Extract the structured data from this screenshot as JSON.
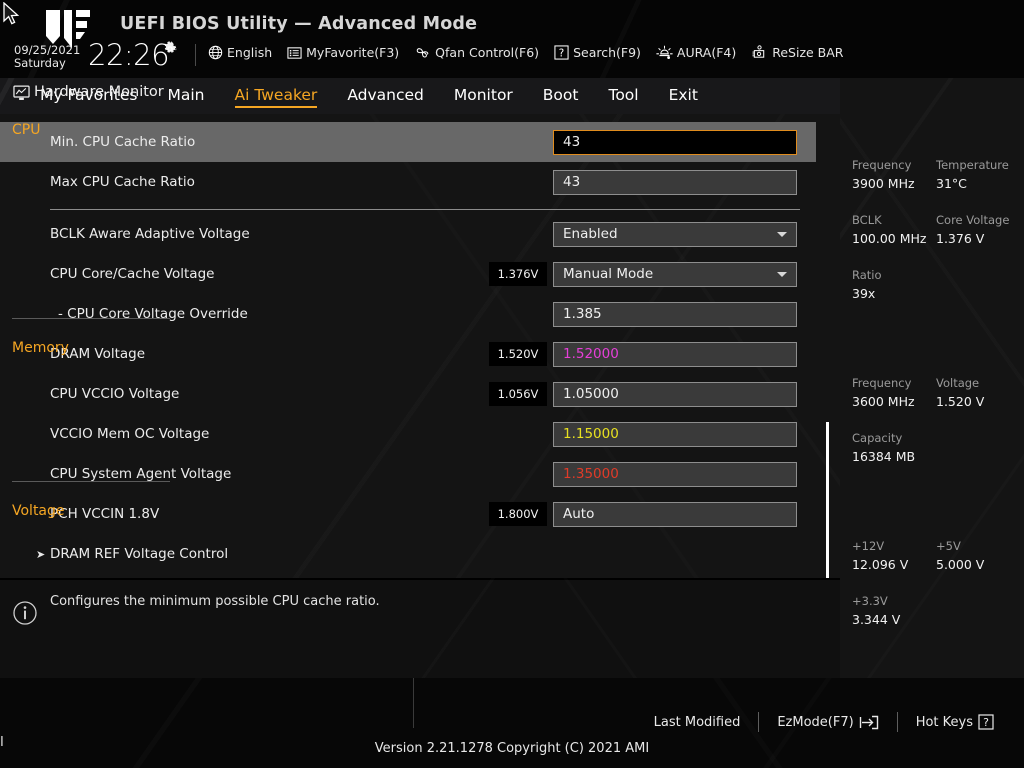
{
  "header": {
    "title": "UEFI BIOS Utility — Advanced Mode",
    "date": "09/25/2021",
    "weekday": "Saturday",
    "time": "22:26",
    "gear_icon": "gear-icon",
    "items": [
      {
        "icon": "globe-icon",
        "label": "English"
      },
      {
        "icon": "list-icon",
        "label": "MyFavorite(F3)"
      },
      {
        "icon": "fan-icon",
        "label": "Qfan Control(F6)"
      },
      {
        "icon": "question-box-icon",
        "label": "Search(F9)"
      },
      {
        "icon": "aura-icon",
        "label": "AURA(F4)"
      },
      {
        "icon": "gpu-icon",
        "label": "ReSize BAR"
      }
    ]
  },
  "nav": {
    "tabs": [
      {
        "label": "My Favorites",
        "active": false
      },
      {
        "label": "Main",
        "active": false
      },
      {
        "label": "Ai Tweaker",
        "active": true
      },
      {
        "label": "Advanced",
        "active": false
      },
      {
        "label": "Monitor",
        "active": false
      },
      {
        "label": "Boot",
        "active": false
      },
      {
        "label": "Tool",
        "active": false
      },
      {
        "label": "Exit",
        "active": false
      }
    ],
    "accent_color": "#f5a623"
  },
  "settings": {
    "rows": [
      {
        "label": "Min. CPU Cache Ratio",
        "value": "43",
        "badge": "",
        "type": "text",
        "selected": true,
        "focused": true,
        "value_color": "#eeeeee",
        "indent": false,
        "submenu": false
      },
      {
        "label": "Max CPU Cache Ratio",
        "value": "43",
        "badge": "",
        "type": "text",
        "selected": false,
        "focused": false,
        "value_color": "#eeeeee",
        "indent": false,
        "submenu": false
      },
      {
        "label": "BCLK Aware Adaptive Voltage",
        "value": "Enabled",
        "badge": "",
        "type": "combo",
        "selected": false,
        "focused": false,
        "value_color": "#eeeeee",
        "indent": false,
        "submenu": false
      },
      {
        "label": "CPU Core/Cache Voltage",
        "value": "Manual Mode",
        "badge": "1.376V",
        "type": "combo",
        "selected": false,
        "focused": false,
        "value_color": "#eeeeee",
        "indent": false,
        "submenu": false
      },
      {
        "label": "- CPU Core Voltage Override",
        "value": "1.385",
        "badge": "",
        "type": "text",
        "selected": false,
        "focused": false,
        "value_color": "#eeeeee",
        "indent": true,
        "submenu": false
      },
      {
        "label": "DRAM Voltage",
        "value": "1.52000",
        "badge": "1.520V",
        "type": "text",
        "selected": false,
        "focused": false,
        "value_color": "#e63fd8",
        "indent": false,
        "submenu": false
      },
      {
        "label": "CPU VCCIO Voltage",
        "value": "1.05000",
        "badge": "1.056V",
        "type": "text",
        "selected": false,
        "focused": false,
        "value_color": "#eeeeee",
        "indent": false,
        "submenu": false
      },
      {
        "label": "VCCIO Mem OC Voltage",
        "value": "1.15000",
        "badge": "",
        "type": "text",
        "selected": false,
        "focused": false,
        "value_color": "#e8e020",
        "indent": false,
        "submenu": false
      },
      {
        "label": "CPU System Agent Voltage",
        "value": "1.35000",
        "badge": "",
        "type": "text",
        "selected": false,
        "focused": false,
        "value_color": "#e03b28",
        "indent": false,
        "submenu": false
      },
      {
        "label": "PCH VCCIN 1.8V",
        "value": "Auto",
        "badge": "1.800V",
        "type": "text",
        "selected": false,
        "focused": false,
        "value_color": "#eeeeee",
        "indent": false,
        "submenu": false
      },
      {
        "label": "DRAM REF Voltage Control",
        "value": "",
        "badge": "",
        "type": "none",
        "selected": false,
        "focused": false,
        "value_color": "#eeeeee",
        "indent": false,
        "submenu": true
      }
    ]
  },
  "help": {
    "icon": "info-icon",
    "text": "Configures the minimum possible CPU cache ratio."
  },
  "hardware_monitor": {
    "title": "Hardware Monitor",
    "icon": "monitor-icon",
    "sections": [
      {
        "name": "CPU",
        "entries": [
          {
            "key": "Frequency",
            "value": "3900 MHz"
          },
          {
            "key": "Temperature",
            "value": "31°C"
          },
          {
            "key": "BCLK",
            "value": "100.00 MHz"
          },
          {
            "key": "Core Voltage",
            "value": "1.376 V"
          },
          {
            "key": "Ratio",
            "value": "39x"
          }
        ]
      },
      {
        "name": "Memory",
        "entries": [
          {
            "key": "Frequency",
            "value": "3600 MHz"
          },
          {
            "key": "Voltage",
            "value": "1.520 V"
          },
          {
            "key": "Capacity",
            "value": "16384 MB"
          }
        ]
      },
      {
        "name": "Voltage",
        "entries": [
          {
            "key": "+12V",
            "value": "12.096 V"
          },
          {
            "key": "+5V",
            "value": "5.000 V"
          },
          {
            "key": "+3.3V",
            "value": "3.344 V"
          }
        ]
      }
    ],
    "section_color": "#f5a623"
  },
  "footer": {
    "last_modified": "Last Modified",
    "ezmode": "EzMode(F7)",
    "hotkeys": "Hot Keys",
    "version": "Version 2.21.1278 Copyright (C) 2021 AMI"
  }
}
